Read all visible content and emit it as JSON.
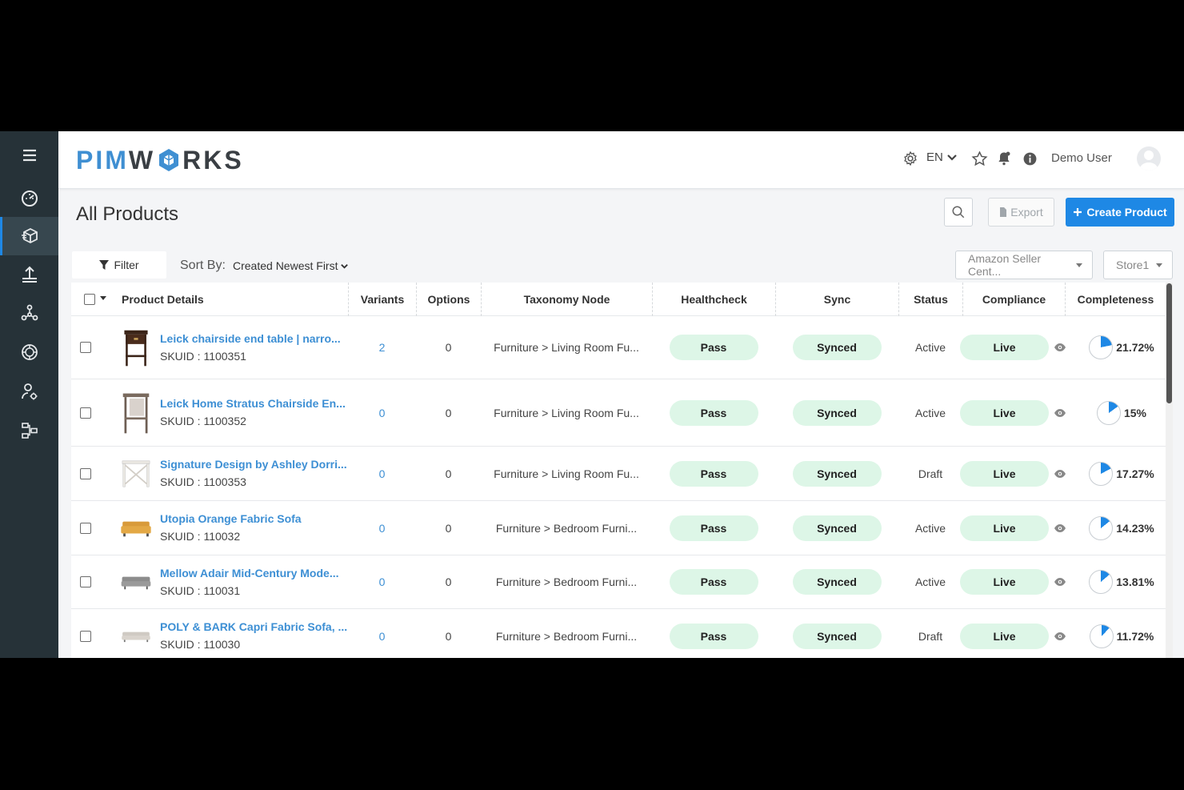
{
  "brand": {
    "logo_a": "PIM",
    "logo_b": "W",
    "logo_c": "RKS",
    "accent": "#1e88e5",
    "sidebar_bg": "#263238"
  },
  "sidebar": {
    "items": [
      {
        "icon": "hamburger-menu-icon"
      },
      {
        "icon": "dashboard-gauge-icon"
      },
      {
        "icon": "products-box-icon",
        "active": true
      },
      {
        "icon": "upload-import-icon"
      },
      {
        "icon": "network-nodes-icon"
      },
      {
        "icon": "ai-brain-icon"
      },
      {
        "icon": "user-settings-icon"
      },
      {
        "icon": "workflow-icon"
      }
    ]
  },
  "header": {
    "language": "EN",
    "user_name": "Demo User"
  },
  "page": {
    "title": "All Products",
    "export_label": "Export",
    "create_label": "Create Product",
    "filter_label": "Filter",
    "sort_label": "Sort By:",
    "sort_value": "Created Newest First",
    "channel_select": "Amazon Seller Cent...",
    "store_select": "Store1"
  },
  "table": {
    "headers": [
      "Product Details",
      "Variants",
      "Options",
      "Taxonomy Node",
      "Healthcheck",
      "Sync",
      "Status",
      "Compliance",
      "Completeness"
    ],
    "rows": [
      {
        "name": "Leick chairside end table | narro...",
        "skuid": "SKUID : 1100351",
        "variants": "2",
        "options": "0",
        "taxonomy": "Furniture > Living Room Fu...",
        "healthcheck": "Pass",
        "sync": "Synced",
        "status": "Active",
        "compliance": "Live",
        "completeness": "21.72%",
        "completeness_value": 21.72,
        "thumb": "end-table-dark"
      },
      {
        "name": "Leick Home Stratus Chairside En...",
        "skuid": "SKUID : 1100352",
        "variants": "0",
        "options": "0",
        "taxonomy": "Furniture > Living Room Fu...",
        "healthcheck": "Pass",
        "sync": "Synced",
        "status": "Active",
        "compliance": "Live",
        "completeness": "15%",
        "completeness_value": 15,
        "thumb": "end-table-grey"
      },
      {
        "name": "Signature Design by Ashley Dorri...",
        "skuid": "SKUID : 1100353",
        "variants": "0",
        "options": "0",
        "taxonomy": "Furniture > Living Room Fu...",
        "healthcheck": "Pass",
        "sync": "Synced",
        "status": "Draft",
        "compliance": "Live",
        "completeness": "17.27%",
        "completeness_value": 17.27,
        "thumb": "side-table-white"
      },
      {
        "name": "Utopia Orange Fabric Sofa",
        "skuid": "SKUID : 110032",
        "variants": "0",
        "options": "0",
        "taxonomy": "Furniture > Bedroom Furni...",
        "healthcheck": "Pass",
        "sync": "Synced",
        "status": "Active",
        "compliance": "Live",
        "completeness": "14.23%",
        "completeness_value": 14.23,
        "thumb": "sofa-orange"
      },
      {
        "name": "Mellow Adair Mid-Century Mode...",
        "skuid": "SKUID : 110031",
        "variants": "0",
        "options": "0",
        "taxonomy": "Furniture > Bedroom Furni...",
        "healthcheck": "Pass",
        "sync": "Synced",
        "status": "Active",
        "compliance": "Live",
        "completeness": "13.81%",
        "completeness_value": 13.81,
        "thumb": "sofa-grey"
      },
      {
        "name": "POLY & BARK Capri Fabric Sofa, ...",
        "skuid": "SKUID : 110030",
        "variants": "0",
        "options": "0",
        "taxonomy": "Furniture > Bedroom Furni...",
        "healthcheck": "Pass",
        "sync": "Synced",
        "status": "Draft",
        "compliance": "Live",
        "completeness": "11.72%",
        "completeness_value": 11.72,
        "thumb": "sofa-light"
      }
    ]
  }
}
